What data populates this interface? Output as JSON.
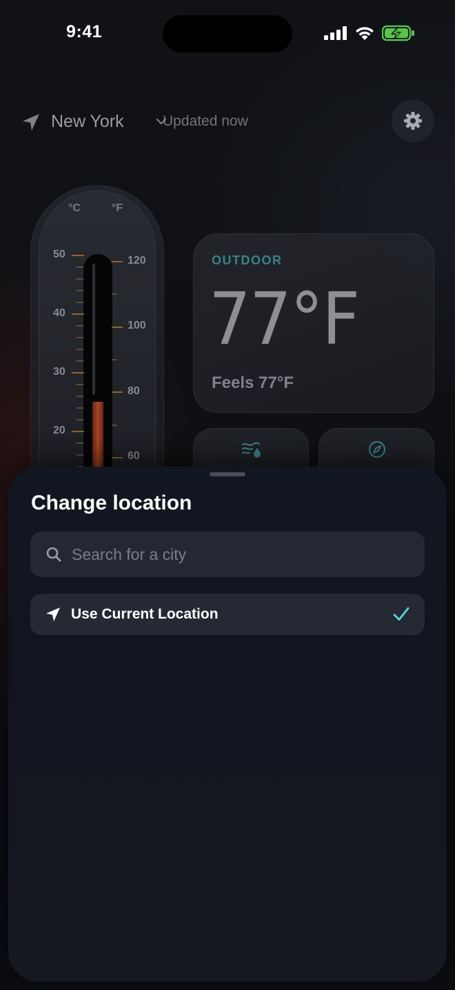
{
  "status_bar": {
    "time": "9:41"
  },
  "header": {
    "city": "New York",
    "updated": "Updated now"
  },
  "thermometer": {
    "unit_c": "°C",
    "unit_f": "°F",
    "celsius_labels": [
      "50",
      "40",
      "30",
      "20"
    ],
    "fahrenheit_labels": [
      "120",
      "100",
      "80",
      "60"
    ],
    "current_temp_f": 77
  },
  "outdoor": {
    "label": "OUTDOOR",
    "temp": "77°F",
    "feels": "Feels 77°F"
  },
  "sheet": {
    "title": "Change location",
    "search_placeholder": "Search for a city",
    "current_location_label": "Use Current Location"
  },
  "colors": {
    "accent_teal": "#3f8f96",
    "check_teal": "#5fd3dc",
    "mercury": "#c5522c"
  }
}
